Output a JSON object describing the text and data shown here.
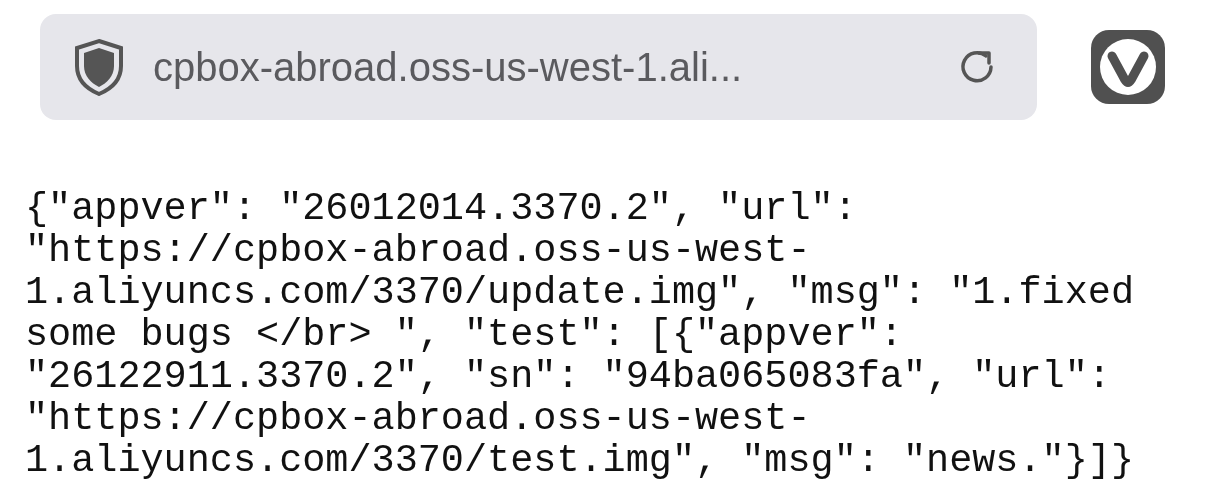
{
  "address_bar": {
    "url": "cpbox-abroad.oss-us-west-1.ali..."
  },
  "content": {
    "lines": [
      "{\"appver\": \"26012014.3370.2\", \"url\":",
      "\"https://cpbox-abroad.oss-us-west-",
      "1.aliyuncs.com/3370/update.img\", \"msg\": \"1.fixed",
      "some bugs </br> \", \"test\": [{\"appver\":",
      "\"26122911.3370.2\", \"sn\": \"94ba065083fa\", \"url\":",
      "\"https://cpbox-abroad.oss-us-west-",
      "1.aliyuncs.com/3370/test.img\", \"msg\": \"news.\"}]}"
    ]
  }
}
